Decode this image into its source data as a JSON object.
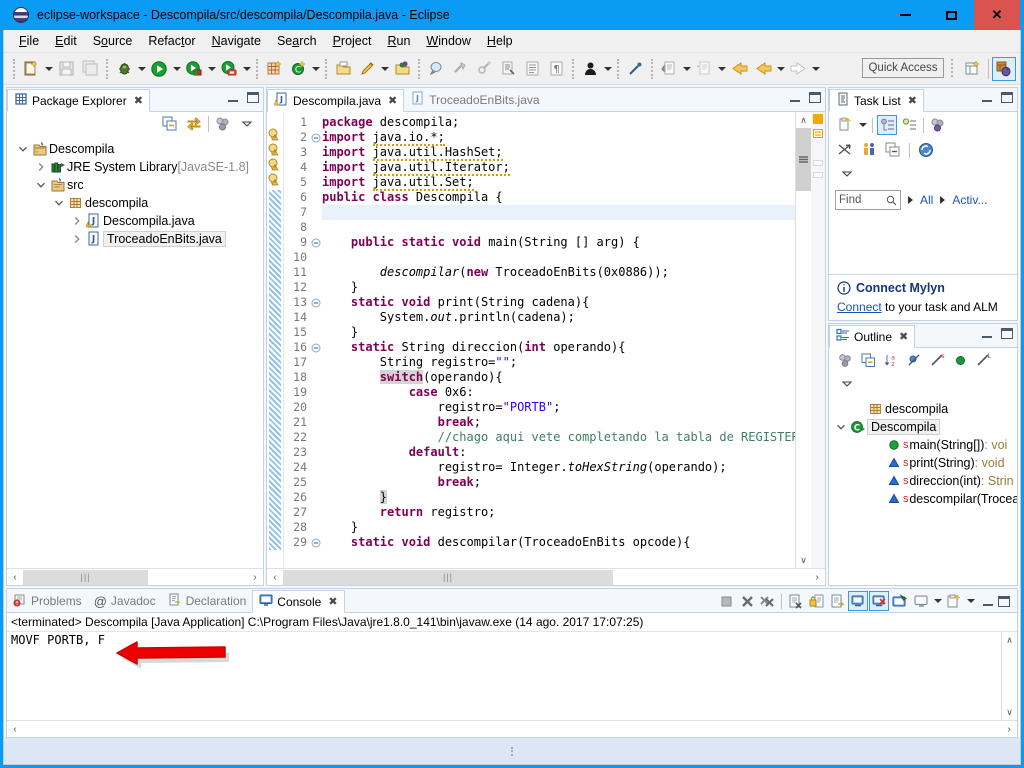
{
  "window": {
    "title": "eclipse-workspace - Descompila/src/descompila/Descompila.java - Eclipse",
    "app_icon": "eclipse-icon",
    "minimize": "–",
    "maximize": "□",
    "close": "✕"
  },
  "menubar": {
    "items": [
      {
        "label": "File",
        "mnemonic": "F"
      },
      {
        "label": "Edit",
        "mnemonic": "E"
      },
      {
        "label": "Source",
        "mnemonic": "o"
      },
      {
        "label": "Refactor",
        "mnemonic": "t"
      },
      {
        "label": "Navigate",
        "mnemonic": "N"
      },
      {
        "label": "Search",
        "mnemonic": "a"
      },
      {
        "label": "Project",
        "mnemonic": "P"
      },
      {
        "label": "Run",
        "mnemonic": "R"
      },
      {
        "label": "Window",
        "mnemonic": "W"
      },
      {
        "label": "Help",
        "mnemonic": "H"
      }
    ]
  },
  "toolbar": {
    "quick_access_placeholder": "Quick Access",
    "buttons": [
      "new-wizard-icon",
      "save-icon",
      "save-all-icon",
      "debug-icon",
      "run-icon",
      "coverage-icon",
      "run-last-icon",
      "new-java-project-icon",
      "new-java-class-icon",
      "open-task-icon",
      "annotation-icon",
      "open-folder-icon",
      "search-icon",
      "skip-breakpoints-icon",
      "external-tools-icon",
      "toggle-markoccur-icon",
      "show-whitespace-icon",
      "block-selection-icon",
      "user-icon",
      "link-icon",
      "next-annotation-icon",
      "prev-annotation-icon",
      "back-icon",
      "forward-nav-icon",
      "forward-icon"
    ],
    "perspective_new": "new-perspective-icon",
    "perspective_java": "java-perspective-icon"
  },
  "package_explorer": {
    "tab_label": "Package Explorer",
    "tab_icon": "package-explorer-icon",
    "toolbar": [
      "collapse-all-icon",
      "link-with-editor-icon",
      "view-menu-icon",
      "view-dropdown-icon"
    ],
    "tree": [
      {
        "label": "Descompila",
        "icon": "java-project-icon",
        "indent": 0,
        "expander": "expanded",
        "dim": "",
        "selected": false
      },
      {
        "label": "JRE System Library",
        "icon": "library-icon",
        "indent": 1,
        "expander": "collapsed",
        "dim": "[JavaSE-1.8]",
        "selected": false
      },
      {
        "label": "src",
        "icon": "source-folder-icon",
        "indent": 1,
        "expander": "expanded",
        "dim": "",
        "selected": false
      },
      {
        "label": "descompila",
        "icon": "package-icon",
        "indent": 2,
        "expander": "expanded",
        "dim": "",
        "selected": false
      },
      {
        "label": "Descompila.java",
        "icon": "java-file-warning-icon",
        "indent": 3,
        "expander": "collapsed",
        "dim": "",
        "selected": false
      },
      {
        "label": "TroceadoEnBits.java",
        "icon": "java-file-icon",
        "indent": 3,
        "expander": "collapsed",
        "dim": "",
        "selected": true
      }
    ],
    "hscroll_thumb": "|||"
  },
  "editor": {
    "tabs": [
      {
        "label": "Descompila.java",
        "icon": "java-file-warning-icon",
        "active": true,
        "close": "✕"
      },
      {
        "label": "TroceadoEnBits.java",
        "icon": "java-file-icon",
        "active": false,
        "close": ""
      }
    ],
    "first_line": 1,
    "lines": [
      {
        "n": 1,
        "fold": "",
        "marker": "",
        "highlight": false,
        "tokens": [
          {
            "t": "package ",
            "c": "kw"
          },
          {
            "t": "descompila;",
            "c": ""
          }
        ]
      },
      {
        "n": 2,
        "fold": "minus",
        "marker": "warning",
        "highlight": false,
        "tokens": [
          {
            "t": "import ",
            "c": "kw"
          },
          {
            "t": "java.io.*;",
            "c": "sq"
          }
        ]
      },
      {
        "n": 3,
        "fold": "",
        "marker": "warning",
        "highlight": false,
        "tokens": [
          {
            "t": "import ",
            "c": "kw"
          },
          {
            "t": "java.util.HashSet;",
            "c": "sq"
          }
        ]
      },
      {
        "n": 4,
        "fold": "",
        "marker": "warning",
        "highlight": false,
        "tokens": [
          {
            "t": "import ",
            "c": "kw"
          },
          {
            "t": "java.util.Iterator;",
            "c": "sq"
          }
        ]
      },
      {
        "n": 5,
        "fold": "",
        "marker": "warning",
        "highlight": false,
        "tokens": [
          {
            "t": "import ",
            "c": "kw"
          },
          {
            "t": "java.util.Set;",
            "c": "sq"
          }
        ]
      },
      {
        "n": 6,
        "fold": "",
        "marker": "",
        "highlight": false,
        "tokens": [
          {
            "t": "public class ",
            "c": "kw"
          },
          {
            "t": "Descompila {",
            "c": ""
          }
        ]
      },
      {
        "n": 7,
        "fold": "",
        "marker": "",
        "highlight": true,
        "tokens": []
      },
      {
        "n": 8,
        "fold": "",
        "marker": "",
        "highlight": false,
        "tokens": []
      },
      {
        "n": 9,
        "fold": "minus",
        "marker": "",
        "highlight": false,
        "tokens": [
          {
            "t": "    ",
            "c": ""
          },
          {
            "t": "public static void ",
            "c": "kw"
          },
          {
            "t": "main(String [] arg) {",
            "c": ""
          }
        ]
      },
      {
        "n": 10,
        "fold": "",
        "marker": "",
        "highlight": false,
        "tokens": []
      },
      {
        "n": 11,
        "fold": "",
        "marker": "",
        "highlight": false,
        "tokens": [
          {
            "t": "        ",
            "c": ""
          },
          {
            "t": "descompilar",
            "c": "mtd"
          },
          {
            "t": "(",
            "c": ""
          },
          {
            "t": "new ",
            "c": "kw"
          },
          {
            "t": "TroceadoEnBits(0x0886));",
            "c": ""
          }
        ]
      },
      {
        "n": 12,
        "fold": "",
        "marker": "",
        "highlight": false,
        "tokens": [
          {
            "t": "    }",
            "c": ""
          }
        ]
      },
      {
        "n": 13,
        "fold": "minus",
        "marker": "",
        "highlight": false,
        "tokens": [
          {
            "t": "    ",
            "c": ""
          },
          {
            "t": "static void ",
            "c": "kw"
          },
          {
            "t": "print(String cadena){",
            "c": ""
          }
        ]
      },
      {
        "n": 14,
        "fold": "",
        "marker": "",
        "highlight": false,
        "tokens": [
          {
            "t": "        System.",
            "c": ""
          },
          {
            "t": "out",
            "c": "stat"
          },
          {
            "t": ".println(cadena);",
            "c": ""
          }
        ]
      },
      {
        "n": 15,
        "fold": "",
        "marker": "",
        "highlight": false,
        "tokens": [
          {
            "t": "    }",
            "c": ""
          }
        ]
      },
      {
        "n": 16,
        "fold": "minus",
        "marker": "",
        "highlight": false,
        "tokens": [
          {
            "t": "    ",
            "c": ""
          },
          {
            "t": "static ",
            "c": "kw"
          },
          {
            "t": "String direccion(",
            "c": ""
          },
          {
            "t": "int ",
            "c": "kw"
          },
          {
            "t": "operando){",
            "c": ""
          }
        ]
      },
      {
        "n": 17,
        "fold": "",
        "marker": "",
        "highlight": false,
        "tokens": [
          {
            "t": "        String registro=",
            "c": ""
          },
          {
            "t": "\"\"",
            "c": "str"
          },
          {
            "t": ";",
            "c": ""
          }
        ]
      },
      {
        "n": 18,
        "fold": "",
        "marker": "",
        "highlight": false,
        "tokens": [
          {
            "t": "        ",
            "c": ""
          },
          {
            "t": "switch",
            "c": "kwhl"
          },
          {
            "t": "(operando){",
            "c": ""
          }
        ]
      },
      {
        "n": 19,
        "fold": "",
        "marker": "",
        "highlight": false,
        "tokens": [
          {
            "t": "            ",
            "c": ""
          },
          {
            "t": "case ",
            "c": "kw"
          },
          {
            "t": "0x6:",
            "c": ""
          }
        ]
      },
      {
        "n": 20,
        "fold": "",
        "marker": "",
        "highlight": false,
        "tokens": [
          {
            "t": "                registro=",
            "c": ""
          },
          {
            "t": "\"PORTB\"",
            "c": "str"
          },
          {
            "t": ";",
            "c": ""
          }
        ]
      },
      {
        "n": 21,
        "fold": "",
        "marker": "",
        "highlight": false,
        "tokens": [
          {
            "t": "                ",
            "c": ""
          },
          {
            "t": "break",
            "c": "kw"
          },
          {
            "t": ";",
            "c": ""
          }
        ]
      },
      {
        "n": 22,
        "fold": "",
        "marker": "",
        "highlight": false,
        "tokens": [
          {
            "t": "                ",
            "c": ""
          },
          {
            "t": "//chago aqui vete completando la tabla de REGISTER FIL",
            "c": "cmt"
          }
        ]
      },
      {
        "n": 23,
        "fold": "",
        "marker": "",
        "highlight": false,
        "tokens": [
          {
            "t": "            ",
            "c": ""
          },
          {
            "t": "default",
            "c": "kw"
          },
          {
            "t": ":",
            "c": ""
          }
        ]
      },
      {
        "n": 24,
        "fold": "",
        "marker": "",
        "highlight": false,
        "tokens": [
          {
            "t": "                registro= Integer.",
            "c": ""
          },
          {
            "t": "toHexString",
            "c": "stat"
          },
          {
            "t": "(operando);",
            "c": ""
          }
        ]
      },
      {
        "n": 25,
        "fold": "",
        "marker": "",
        "highlight": false,
        "tokens": [
          {
            "t": "                ",
            "c": ""
          },
          {
            "t": "break",
            "c": "kw"
          },
          {
            "t": ";",
            "c": ""
          }
        ]
      },
      {
        "n": 26,
        "fold": "",
        "marker": "",
        "highlight": false,
        "tokens": [
          {
            "t": "        ",
            "c": ""
          },
          {
            "t": "}",
            "c": "hl"
          }
        ]
      },
      {
        "n": 27,
        "fold": "",
        "marker": "",
        "highlight": false,
        "tokens": [
          {
            "t": "        ",
            "c": ""
          },
          {
            "t": "return ",
            "c": "kw"
          },
          {
            "t": "registro;",
            "c": ""
          }
        ]
      },
      {
        "n": 28,
        "fold": "",
        "marker": "",
        "highlight": false,
        "tokens": [
          {
            "t": "    }",
            "c": ""
          }
        ]
      },
      {
        "n": 29,
        "fold": "minus",
        "marker": "",
        "highlight": false,
        "tokens": [
          {
            "t": "    ",
            "c": ""
          },
          {
            "t": "static void ",
            "c": "kw"
          },
          {
            "t": "descompilar(TroceadoEnBits opcode){",
            "c": ""
          }
        ]
      }
    ],
    "hscroll_thumb": "|||"
  },
  "task_list": {
    "tab_label": "Task List",
    "tab_icon": "task-list-icon",
    "toolbar": [
      "new-task-icon",
      "task-dropdown-icon",
      "categorized-icon",
      "scheduled-icon",
      "focus-icon"
    ],
    "toolbar2": [
      "collapse-icon",
      "presentation-icon",
      "restore-icon",
      "synchronize-icon"
    ],
    "find_placeholder": "Find",
    "find_icon": "search-icon",
    "filter_all": "All",
    "filter_active": "Activ...",
    "banner": {
      "icon": "info-icon",
      "title": "Connect Mylyn",
      "link": "Connect",
      "text": " to your task and ALM"
    }
  },
  "outline": {
    "tab_label": "Outline",
    "tab_icon": "outline-icon",
    "toolbar": [
      "focus-icon",
      "collapse-all-icon",
      "sort-icon",
      "hide-fields-icon",
      "hide-static-icon",
      "hide-nonpublic-icon",
      "hide-local-icon"
    ],
    "items": [
      {
        "label": "descompila",
        "icon": "package-icon",
        "indent": 1,
        "expander": "",
        "suffix": "",
        "selected": false,
        "badge": ""
      },
      {
        "label": "Descompila",
        "icon": "class-icon",
        "indent": 0,
        "expander": "expanded",
        "suffix": "",
        "selected": true,
        "badge": ""
      },
      {
        "label": "main(String[])",
        "icon": "method-public-icon",
        "indent": 2,
        "expander": "",
        "suffix": " : voi",
        "selected": false,
        "badge": "S"
      },
      {
        "label": "print(String)",
        "icon": "method-default-icon",
        "indent": 2,
        "expander": "",
        "suffix": " : void",
        "selected": false,
        "badge": "S"
      },
      {
        "label": "direccion(int)",
        "icon": "method-default-icon",
        "indent": 2,
        "expander": "",
        "suffix": " : Strin",
        "selected": false,
        "badge": "S"
      },
      {
        "label": "descompilar(Trocea",
        "icon": "method-default-icon",
        "indent": 2,
        "expander": "",
        "suffix": "",
        "selected": false,
        "badge": "S"
      }
    ]
  },
  "bottom_panel": {
    "tabs": [
      {
        "label": "Problems",
        "icon": "problems-icon",
        "active": false,
        "close": ""
      },
      {
        "label": "Javadoc",
        "icon": "javadoc-icon",
        "active": false,
        "close": ""
      },
      {
        "label": "Declaration",
        "icon": "declaration-icon",
        "active": false,
        "close": ""
      },
      {
        "label": "Console",
        "icon": "console-icon",
        "active": true,
        "close": "✕"
      }
    ],
    "toolbar": [
      "terminate-icon",
      "remove-launch-icon",
      "remove-all-launches-icon",
      "clear-console-icon",
      "scroll-lock-icon",
      "word-wrap-icon",
      "show-console-stdout-icon",
      "show-console-stderr-icon",
      "pin-console-icon",
      "display-console-icon",
      "display-dropdown-icon",
      "open-console-icon",
      "open-console-dropdown-icon"
    ],
    "terminated_line": "<terminated> Descompila [Java Application] C:\\Program Files\\Java\\jre1.8.0_141\\bin\\javaw.exe (14 ago. 2017 17:07:25)",
    "output": "MOVF  PORTB, F",
    "annotation": "red-arrow-annotation",
    "hscroll_thumb": ""
  },
  "statusbar": {
    "grip": "resize-grip"
  },
  "colors": {
    "title_bar": "#0a9cf5",
    "close_button": "#d9534f",
    "accent": "#3a9ad9",
    "keyword": "#7f0055",
    "string": "#2a00ff",
    "comment": "#3f7f5f",
    "field": "#0000c0",
    "selection_highlight": "#e8f2fc",
    "annotation_red": "#ee0000",
    "link": "#1a54b8",
    "statusbar_bg": "#dde6f5"
  }
}
